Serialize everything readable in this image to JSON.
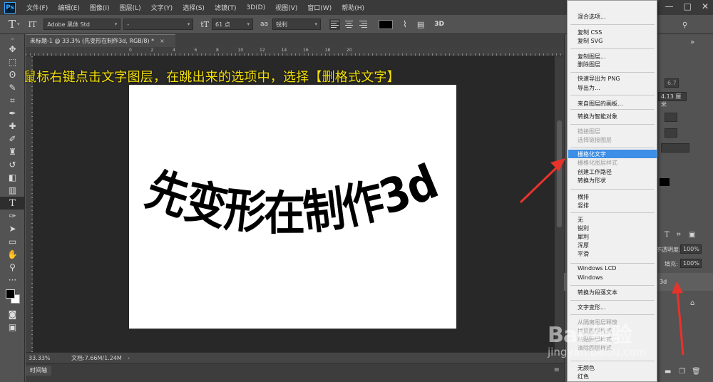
{
  "app": {
    "logo": "Ps",
    "menu": [
      "文件(F)",
      "编辑(E)",
      "图像(I)",
      "图层(L)",
      "文字(Y)",
      "选择(S)",
      "滤镜(T)",
      "3D(D)",
      "视图(V)",
      "窗口(W)",
      "帮助(H)"
    ],
    "window_controls": [
      "—",
      "□",
      "✕"
    ]
  },
  "options": {
    "tool_icon": "T",
    "orient_icon": "IT",
    "font_family": "Adobe 黑体 Std",
    "font_style": "-",
    "size_icon": "tT",
    "font_size": "61 点",
    "aa_label": "aa",
    "anti_alias": "锐利",
    "warp_label": "3D",
    "text_color": "#000000"
  },
  "document": {
    "tab_title": "未标题-1 @ 33.3% (先变形在制作3d, RGB/8) *",
    "close": "×",
    "canvas_text": "先变形在制作3d",
    "ruler_ticks": [
      "0",
      "2",
      "4",
      "6",
      "8",
      "10",
      "12",
      "14",
      "16",
      "18",
      "20"
    ]
  },
  "caption": "鼠标右键点击文字图层，在跳出来的选项中，选择【删格式文字】",
  "status": {
    "zoom": "33.33%",
    "doc_info": "文档:7.66M/1.24M",
    "arrow": "›"
  },
  "timeline": {
    "tab": "时间轴",
    "menu": "≡"
  },
  "right_panel": {
    "value_6": "6.7",
    "value_measure": "4.13 厘米",
    "opacity_label": "不透明度:",
    "opacity_value": "100%",
    "fill_label": "填充:",
    "fill_value": "100%",
    "layer_name": "3d"
  },
  "context_menu": {
    "items": [
      {
        "label": "混合选项...",
        "disabled": false
      },
      {
        "label": "复制 CSS",
        "disabled": false
      },
      {
        "label": "复制 SVG",
        "disabled": false
      },
      {
        "label": "复制图层...",
        "disabled": false
      },
      {
        "label": "删除图层",
        "disabled": false
      },
      {
        "label": "快速导出为 PNG",
        "disabled": false
      },
      {
        "label": "导出为...",
        "disabled": false
      },
      {
        "label": "来自图层的画板...",
        "disabled": false
      },
      {
        "label": "转换为智能对象",
        "disabled": false
      },
      {
        "label": "链接图层",
        "disabled": true
      },
      {
        "label": "选择链接图层",
        "disabled": true
      },
      {
        "label": "栅格化文字",
        "disabled": false,
        "highlighted": true
      },
      {
        "label": "栅格化图层样式",
        "disabled": true
      },
      {
        "label": "创建工作路径",
        "disabled": false
      },
      {
        "label": "转换为形状",
        "disabled": false
      },
      {
        "label": "横排",
        "disabled": false
      },
      {
        "label": "竖排",
        "disabled": false
      },
      {
        "label": "无",
        "disabled": false
      },
      {
        "label": "锐利",
        "disabled": false
      },
      {
        "label": "犀利",
        "disabled": false
      },
      {
        "label": "浑厚",
        "disabled": false
      },
      {
        "label": "平滑",
        "disabled": false
      },
      {
        "label": "Windows LCD",
        "disabled": false
      },
      {
        "label": "Windows",
        "disabled": false
      },
      {
        "label": "转换为段落文本",
        "disabled": false
      },
      {
        "label": "文字变形...",
        "disabled": false
      },
      {
        "label": "从隔离图层释放",
        "disabled": true
      },
      {
        "label": "拷贝图层样式",
        "disabled": true
      },
      {
        "label": "粘贴图层样式",
        "disabled": true
      },
      {
        "label": "清除图层样式",
        "disabled": true
      },
      {
        "label": "无颜色",
        "disabled": false
      },
      {
        "label": "红色",
        "disabled": false
      }
    ]
  },
  "watermark": {
    "big": "Bai 经验",
    "small": "jingyan.baidu.com"
  },
  "colors": {
    "annotation_red": "#e8332a",
    "caption_yellow": "#f5e10a",
    "menu_highlight": "#3c8ee6"
  }
}
